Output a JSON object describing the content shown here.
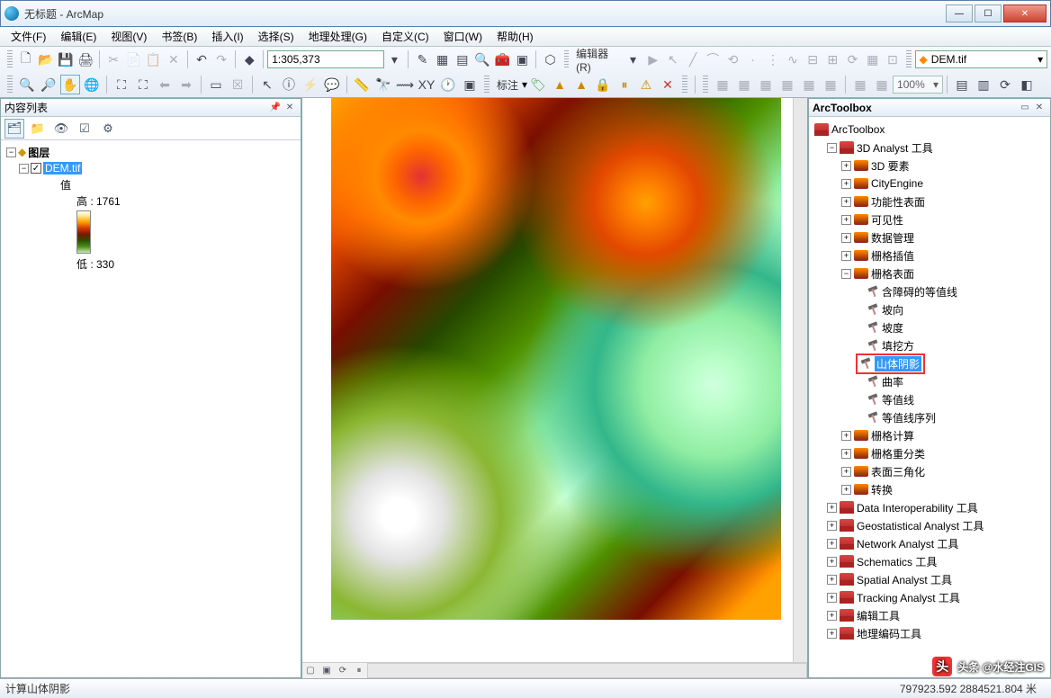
{
  "window": {
    "title": "无标题 - ArcMap"
  },
  "menu": [
    "文件(F)",
    "编辑(E)",
    "视图(V)",
    "书签(B)",
    "插入(I)",
    "选择(S)",
    "地理处理(G)",
    "自定义(C)",
    "窗口(W)",
    "帮助(H)"
  ],
  "toolbar": {
    "scale": "1:305,373",
    "editor_label": "编辑器(R)",
    "layer_select": "DEM.tif",
    "annotate_label": "标注",
    "zoom_percent": "100%"
  },
  "toc": {
    "title": "内容列表",
    "root": "图层",
    "layer": "DEM.tif",
    "value_label": "值",
    "high_label": "高 : 1761",
    "low_label": "低 : 330"
  },
  "arctoolbox": {
    "title": "ArcToolbox",
    "root": "ArcToolbox",
    "group_3d": "3D Analyst 工具",
    "items_3d": [
      "3D 要素",
      "CityEngine",
      "功能性表面",
      "可见性",
      "数据管理",
      "栅格插值"
    ],
    "raster_surface": "栅格表面",
    "raster_tools": [
      "含障碍的等值线",
      "坡向",
      "坡度",
      "填挖方",
      "山体阴影",
      "曲率",
      "等值线",
      "等值线序列"
    ],
    "items_3d_after": [
      "栅格计算",
      "栅格重分类",
      "表面三角化",
      "转换"
    ],
    "other_toolboxes": [
      "Data Interoperability 工具",
      "Geostatistical Analyst 工具",
      "Network Analyst 工具",
      "Schematics 工具",
      "Spatial Analyst 工具",
      "Tracking Analyst 工具",
      "编辑工具",
      "地理编码工具"
    ]
  },
  "status": {
    "left": "计算山体阴影",
    "coords": "797923.592  2884521.804 米"
  },
  "watermark": "头条 @水经注GIS"
}
